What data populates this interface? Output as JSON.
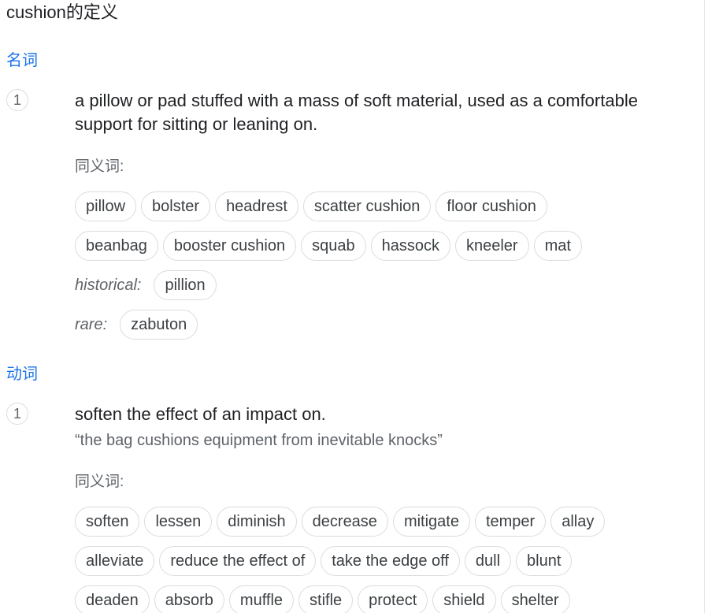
{
  "title": "cushion的定义",
  "noun": {
    "label": "名词",
    "sense_number": "1",
    "definition": "a pillow or pad stuffed with a mass of soft material, used as a comfortable support for sitting or leaning on.",
    "synonyms_heading": "同义词:",
    "row1": [
      "pillow",
      "bolster",
      "headrest",
      "scatter cushion",
      "floor cushion"
    ],
    "row2": [
      "beanbag",
      "booster cushion",
      "squab",
      "hassock",
      "kneeler",
      "mat"
    ],
    "historical": {
      "label": "historical:",
      "chips": [
        "pillion"
      ]
    },
    "rare": {
      "label": "rare:",
      "chips": [
        "zabuton"
      ]
    }
  },
  "verb": {
    "label": "动词",
    "sense_number": "1",
    "definition": "soften the effect of an impact on.",
    "example": "“the bag cushions equipment from inevitable knocks”",
    "synonyms_heading": "同义词:",
    "row1": [
      "soften",
      "lessen",
      "diminish",
      "decrease",
      "mitigate",
      "temper",
      "allay"
    ],
    "row2": [
      "alleviate",
      "reduce the effect of",
      "take the edge off",
      "dull",
      "blunt"
    ],
    "row3": [
      "deaden",
      "absorb",
      "muffle",
      "stifle",
      "protect",
      "shield",
      "shelter"
    ]
  }
}
